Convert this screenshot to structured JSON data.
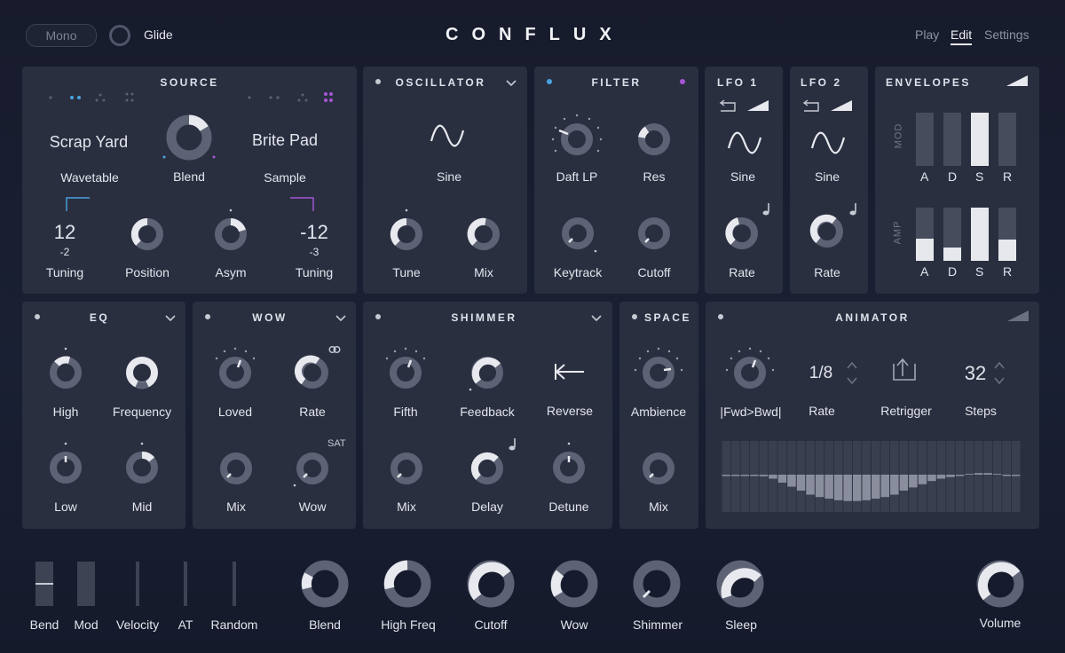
{
  "top": {
    "mono": "Mono",
    "glide": "Glide",
    "logo": "CONFLUX",
    "nav": [
      "Play",
      "Edit",
      "Settings"
    ],
    "active_nav": "Edit"
  },
  "source": {
    "title": "SOURCE",
    "left_name": "Scrap Yard",
    "left_type": "Wavetable",
    "right_name": "Brite Pad",
    "right_type": "Sample",
    "blend": "Blend",
    "left_tuning": "12",
    "left_tuning_fine": "-2",
    "right_tuning": "-12",
    "right_tuning_fine": "-3",
    "tuning": "Tuning",
    "position": "Position",
    "asym": "Asym",
    "left_color": "#4aa3e0",
    "right_color": "#a855d6"
  },
  "oscillator": {
    "title": "OSCILLATOR",
    "wave": "Sine",
    "tune": "Tune",
    "mix": "Mix"
  },
  "filter": {
    "title": "FILTER",
    "type": "Daft LP",
    "res": "Res",
    "keytrack": "Keytrack",
    "cutoff": "Cutoff"
  },
  "lfo1": {
    "title": "LFO 1",
    "wave": "Sine",
    "rate": "Rate"
  },
  "lfo2": {
    "title": "LFO 2",
    "wave": "Sine",
    "rate": "Rate"
  },
  "envelopes": {
    "title": "ENVELOPES",
    "mod_label": "MOD",
    "amp_label": "AMP",
    "stages": [
      "A",
      "D",
      "S",
      "R"
    ],
    "mod_levels": [
      0,
      0,
      1.0,
      0
    ],
    "amp_levels": [
      0.42,
      0.25,
      1.0,
      0.4
    ]
  },
  "eq": {
    "title": "EQ",
    "high": "High",
    "frequency": "Frequency",
    "low": "Low",
    "mid": "Mid"
  },
  "wow": {
    "title": "WOW",
    "loved": "Loved",
    "rate": "Rate",
    "mix": "Mix",
    "wow": "Wow",
    "sat": "SAT"
  },
  "shimmer": {
    "title": "SHIMMER",
    "fifth": "Fifth",
    "feedback": "Feedback",
    "reverse": "Reverse",
    "mix": "Mix",
    "delay": "Delay",
    "detune": "Detune"
  },
  "space": {
    "title": "SPACE",
    "ambience": "Ambience",
    "mix": "Mix"
  },
  "animator": {
    "title": "ANIMATOR",
    "mode": "|Fwd>Bwd|",
    "rate_value": "1/8",
    "rate": "Rate",
    "retrigger": "Retrigger",
    "steps_value": "32",
    "steps": "Steps",
    "step_values": [
      0,
      0,
      0,
      0,
      0.02,
      0.05,
      0.1,
      0.15,
      0.2,
      0.25,
      0.28,
      0.3,
      0.32,
      0.33,
      0.33,
      0.32,
      0.3,
      0.28,
      0.25,
      0.2,
      0.16,
      0.12,
      0.08,
      0.05,
      0.03,
      0.01,
      -0.01,
      -0.02,
      -0.02,
      -0.01,
      0,
      0.01
    ]
  },
  "bottom": {
    "bend": "Bend",
    "mod": "Mod",
    "velocity": "Velocity",
    "at": "AT",
    "random": "Random",
    "macros": [
      "Blend",
      "High Freq",
      "Cutoff",
      "Wow",
      "Shimmer",
      "Sleep"
    ],
    "volume": "Volume"
  }
}
